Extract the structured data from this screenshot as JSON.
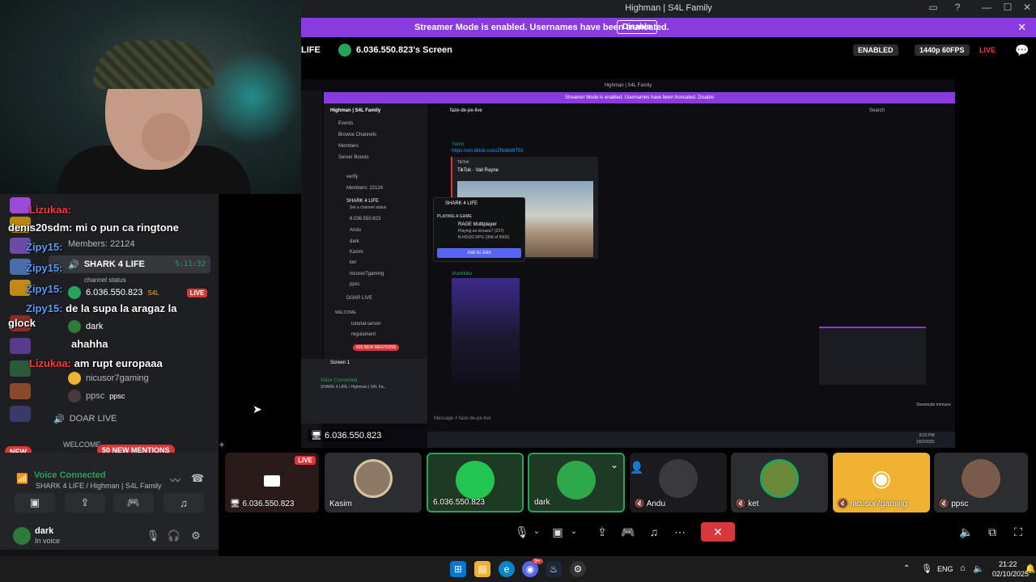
{
  "window": {
    "title": "Highman | S4L Family"
  },
  "streamer_banner": {
    "message": "Streamer Mode is enabled. Usernames have been truncated.",
    "disable_label": "Disable"
  },
  "stream_header": {
    "channel_fragment": "LIFE",
    "screen_title": "6.036.550.823's Screen",
    "enabled_tag": "ENABLED",
    "quality_tag": "1440p 60FPS",
    "live_tag": "LIVE"
  },
  "chat": {
    "messages": [
      {
        "user": "Lizukaa:",
        "text": "",
        "color": "red"
      },
      {
        "user": "denis20sdm:",
        "text": "mi o pun ca ringtone",
        "color": "white"
      },
      {
        "user": "Zipy15:",
        "text": "",
        "color": "blue"
      },
      {
        "user": "Zipy15:",
        "text": "",
        "color": "blue"
      },
      {
        "user": "Zipy15:",
        "text": "de la supa la aragaz la",
        "color": "blue"
      },
      {
        "user": "",
        "text": "glock",
        "color": "white"
      },
      {
        "user": "",
        "text": "ahahha",
        "color": "white"
      },
      {
        "user": "Lizukaa:",
        "text": "am rupt europaaa",
        "color": "red"
      }
    ]
  },
  "voice_channel": {
    "members_label": "Members: 22124",
    "channel_name": "SHARK 4 LIFE",
    "channel_timer": "5:11:32",
    "channel_status": "channel status",
    "members": [
      {
        "name": "6.036.550.823",
        "tag": "S4L",
        "live": "LIVE"
      },
      {
        "name": "dark"
      },
      {
        "name": "ahahha",
        "tag": "S4L"
      },
      {
        "name": "nicusor7gaming"
      },
      {
        "name": "ppsc",
        "tag": "ppsc"
      }
    ],
    "doar_live": "DOAR LIVE",
    "welcome": "WELCOME",
    "tutorial": "tutorial-server",
    "new_mentions": "50 NEW MENTIONS",
    "new_badge": "NEW"
  },
  "voice_connected": {
    "title": "Voice Connected",
    "subtitle": "SHARK 4 LIFE / Highman | S4L Family"
  },
  "user": {
    "name": "dark",
    "status": "In voice"
  },
  "inner_stream": {
    "title": "Highman | S4L Family",
    "streamer_msg": "Streamer Mode is enabled. Usernames have been truncated.",
    "disable": "Disable",
    "server_name": "Highman | S4L Family",
    "channel": "faze-de-pe-live",
    "search": "Search",
    "channels": [
      "Events",
      "Browse Channels",
      "Members",
      "Server Boosts",
      "verify",
      "Members: 22124",
      "SHARK 4 LIFE",
      "Set a channel status",
      "6.036.550.823",
      "Andu",
      "dark",
      "Kasim",
      "ket",
      "nicusor7gaming",
      "ppsc",
      "DOAR LIVE",
      "WELCOME",
      "tutorial-server",
      "regulament"
    ],
    "new_mentions": "426 NEW MENTIONS",
    "msg_user1": "Yanni",
    "msg_link": "https://vm.tiktok.com/ZNdteWT5t/",
    "embed_source": "TikTok",
    "embed_title": "TikTok · Vali Rayne",
    "msg_user2": "sharkkiku",
    "popup_channel": "SHARK 4 LIFE",
    "popup_playing": "PLAYING A GAME",
    "popup_game": "RAGE Multiplayer",
    "popup_detail1": "Playing as nicusor7 (237)",
    "popup_detail2": "B-HOOD RPG (358 of 5000)",
    "popup_button": "Ask to Join",
    "message_placeholder": "Message # faze-de-pe-live",
    "screen_label": "Screen 1",
    "voice_connected": "Voice Connected",
    "vc_sub": "SHARK 4 LIFE / Highman | S4L Fa...",
    "slowmode": "Slowmode Immune",
    "clock": "8:22 PM",
    "date": "10/2/2025"
  },
  "stream_label": "6.036.550.823",
  "tiles": [
    {
      "name": "6.036.550.823",
      "live": "LIVE"
    },
    {
      "name": "Kasim"
    },
    {
      "name": "6.036.550.823"
    },
    {
      "name": "dark"
    },
    {
      "name": "Andu"
    },
    {
      "name": "ket"
    },
    {
      "name": "nicusor7gaming"
    },
    {
      "name": "ppsc"
    }
  ],
  "taskbar": {
    "lang": "ENG",
    "time": "21:22",
    "date": "02/10/2025",
    "notif_count": "9+"
  },
  "colors": {
    "accent": "#8a3be0",
    "green": "#23a55a",
    "red": "#da373c",
    "blurple": "#5865f2"
  }
}
